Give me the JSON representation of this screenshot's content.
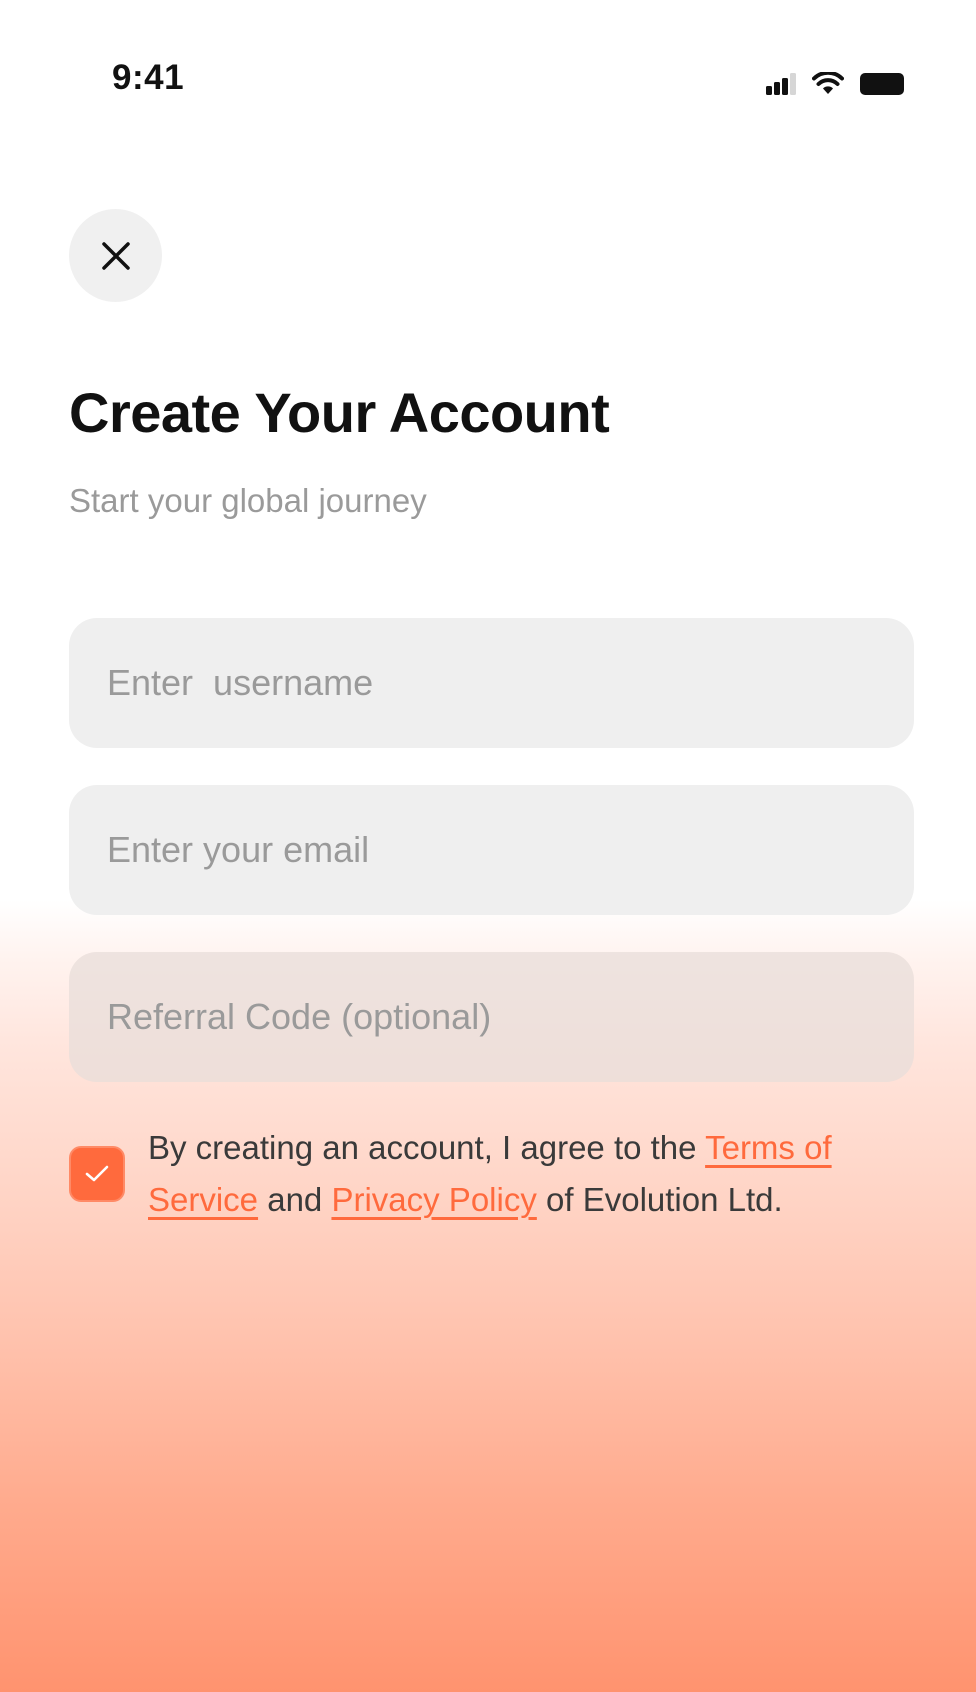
{
  "status_bar": {
    "time": "9:41",
    "icons": [
      "signal-icon",
      "wifi-icon",
      "battery-icon"
    ]
  },
  "close_icon": "close-icon",
  "header": {
    "title": "Create Your Account",
    "subtitle": "Start your global journey"
  },
  "form": {
    "username_placeholder": "Enter  username",
    "email_placeholder": "Enter your email",
    "referral_placeholder": "Referral Code (optional)"
  },
  "terms": {
    "checked": true,
    "text_before": "By creating an account, I agree to the ",
    "terms_link": "Terms of Service",
    "text_middle": " and ",
    "privacy_link": "Privacy Policy",
    "text_after": " of Evolution Ltd."
  },
  "colors": {
    "accent": "#ff6a3d",
    "field_background": "#efefef",
    "placeholder": "#9a9a9a",
    "gradient_bottom": "#ff936f"
  }
}
